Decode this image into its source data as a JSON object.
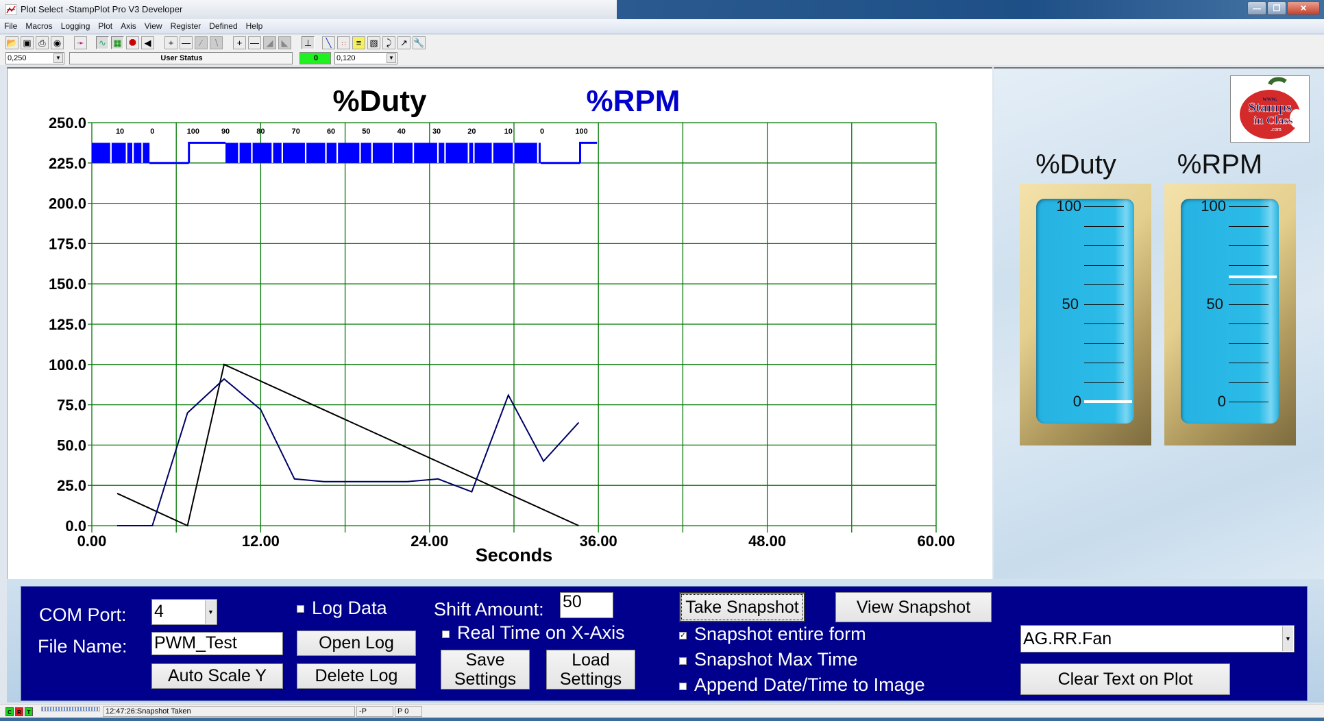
{
  "window": {
    "title": "Plot Select -StampPlot Pro V3 Developer",
    "buttons": [
      "minimize",
      "restore",
      "close"
    ]
  },
  "menu": [
    "File",
    "Macros",
    "Logging",
    "Plot",
    "Axis",
    "View",
    "Register",
    "Defined",
    "Help"
  ],
  "toolbar": {
    "icons": [
      "open-icon",
      "save-icon",
      "print-icon",
      "camera-icon",
      "magic-wand-icon",
      "plot-connect-icon",
      "grid-icon",
      "stop-icon",
      "back-arrow-icon",
      "zoom-in-x-icon",
      "zoom-out-x-icon",
      "shift-left-icon",
      "shift-right-icon",
      "zoom-in-y-icon",
      "zoom-out-y-icon",
      "scroll-up-icon",
      "scroll-down-icon",
      "plot-axis-icon",
      "pen-icon",
      "points-icon",
      "notes-icon",
      "calculator-icon",
      "pointer-icon",
      "chart-icon",
      "wrench-icon"
    ],
    "interval_value": "0,250",
    "user_status": "User Status",
    "counter_value": "0",
    "span_value": "0,120",
    "counter_color": "#20f020"
  },
  "plot": {
    "title_left": "%Duty",
    "title_right": "%RPM",
    "title_left_color": "#000000",
    "title_right_color": "#0000cc"
  },
  "chart_data": {
    "type": "line",
    "title": "%Duty  %RPM",
    "xlabel": "Seconds",
    "ylabel": "",
    "xlim": [
      0,
      60
    ],
    "ylim": [
      0,
      250
    ],
    "x_ticks": [
      "0.00",
      "12.00",
      "24.00",
      "36.00",
      "48.00",
      "60.00"
    ],
    "y_ticks": [
      "0.0",
      "25.0",
      "50.0",
      "75.0",
      "100.0",
      "125.0",
      "150.0",
      "175.0",
      "200.0",
      "225.0",
      "250.0"
    ],
    "grid": true,
    "grid_color": "#007700",
    "series": [
      {
        "name": "%Duty",
        "color": "#000000",
        "x": [
          1.8,
          6.8,
          9.4,
          34.6
        ],
        "y": [
          20,
          0,
          100,
          0
        ]
      },
      {
        "name": "%RPM",
        "color": "#000066",
        "x": [
          1.8,
          4.3,
          6.8,
          9.4,
          12.0,
          14.4,
          16.5,
          22.4,
          24.6,
          27.0,
          29.6,
          32.1,
          34.6
        ],
        "y": [
          0,
          0,
          70,
          91,
          72,
          29,
          27.3,
          27.3,
          29,
          21,
          81,
          40,
          64
        ]
      }
    ],
    "digital_strip": {
      "color": "#0000ff",
      "band": [
        225,
        237.5
      ],
      "annotations": [
        {
          "x": 2,
          "label": "10"
        },
        {
          "x": 4.3,
          "label": "0"
        },
        {
          "x": 7.2,
          "label": "100"
        },
        {
          "x": 9.5,
          "label": "90"
        },
        {
          "x": 12,
          "label": "80"
        },
        {
          "x": 14.5,
          "label": "70"
        },
        {
          "x": 17,
          "label": "60"
        },
        {
          "x": 19.5,
          "label": "50"
        },
        {
          "x": 22,
          "label": "40"
        },
        {
          "x": 24.5,
          "label": "30"
        },
        {
          "x": 27,
          "label": "20"
        },
        {
          "x": 29.6,
          "label": "10"
        },
        {
          "x": 32,
          "label": "0"
        },
        {
          "x": 34.8,
          "label": "100"
        }
      ],
      "segments": [
        {
          "from": 0,
          "to": 4.1,
          "state": "pwm"
        },
        {
          "from": 4.1,
          "to": 6.9,
          "state": "low"
        },
        {
          "from": 6.9,
          "to": 9.5,
          "state": "high"
        },
        {
          "from": 9.5,
          "to": 31.9,
          "state": "pwm"
        },
        {
          "from": 31.9,
          "to": 34.7,
          "state": "low"
        },
        {
          "from": 34.7,
          "to": 35.9,
          "state": "high"
        }
      ]
    }
  },
  "gauges": [
    {
      "title": "%Duty",
      "labels": [
        "100",
        "50",
        "0"
      ],
      "value": 0
    },
    {
      "title": "%RPM",
      "labels": [
        "100",
        "50",
        "0"
      ],
      "value": 64
    }
  ],
  "logo": {
    "line1": "www.",
    "line2": "Stamps",
    "line3": "in Class",
    "line4": ".com"
  },
  "controls": {
    "com_port_label": "COM Port:",
    "com_port_value": "4",
    "file_name_label": "File Name:",
    "file_name_value": "PWM_Test",
    "auto_scale_label": "Auto Scale Y",
    "log_data_label": "Log Data",
    "log_data_checked": false,
    "open_log_label": "Open Log",
    "delete_log_label": "Delete Log",
    "shift_amount_label": "Shift Amount:",
    "shift_amount_value": "50",
    "real_time_label": "Real Time on X-Axis",
    "real_time_checked": false,
    "save_settings_label": "Save Settings",
    "save_settings_line1": "Save",
    "save_settings_line2": "Settings",
    "load_settings_line1": "Load",
    "load_settings_line2": "Settings",
    "take_snapshot_label": "Take Snapshot",
    "view_snapshot_label": "View Snapshot",
    "snapshot_entire_form_label": "Snapshot entire form",
    "snapshot_entire_form_checked": true,
    "snapshot_max_time_label": "Snapshot Max Time",
    "snapshot_max_time_checked": false,
    "append_date_label": "Append Date/Time to Image",
    "append_date_checked": false,
    "macro_select_value": "AG.RR.Fan",
    "clear_text_label": "Clear Text on Plot"
  },
  "status": {
    "leds": [
      {
        "label": "C",
        "color": "#20d020"
      },
      {
        "label": "R",
        "color": "#e02020"
      },
      {
        "label": "T",
        "color": "#20d020"
      }
    ],
    "message": "12:47:26:Snapshot Taken",
    "cell2": "-P",
    "cell3": "P 0"
  }
}
